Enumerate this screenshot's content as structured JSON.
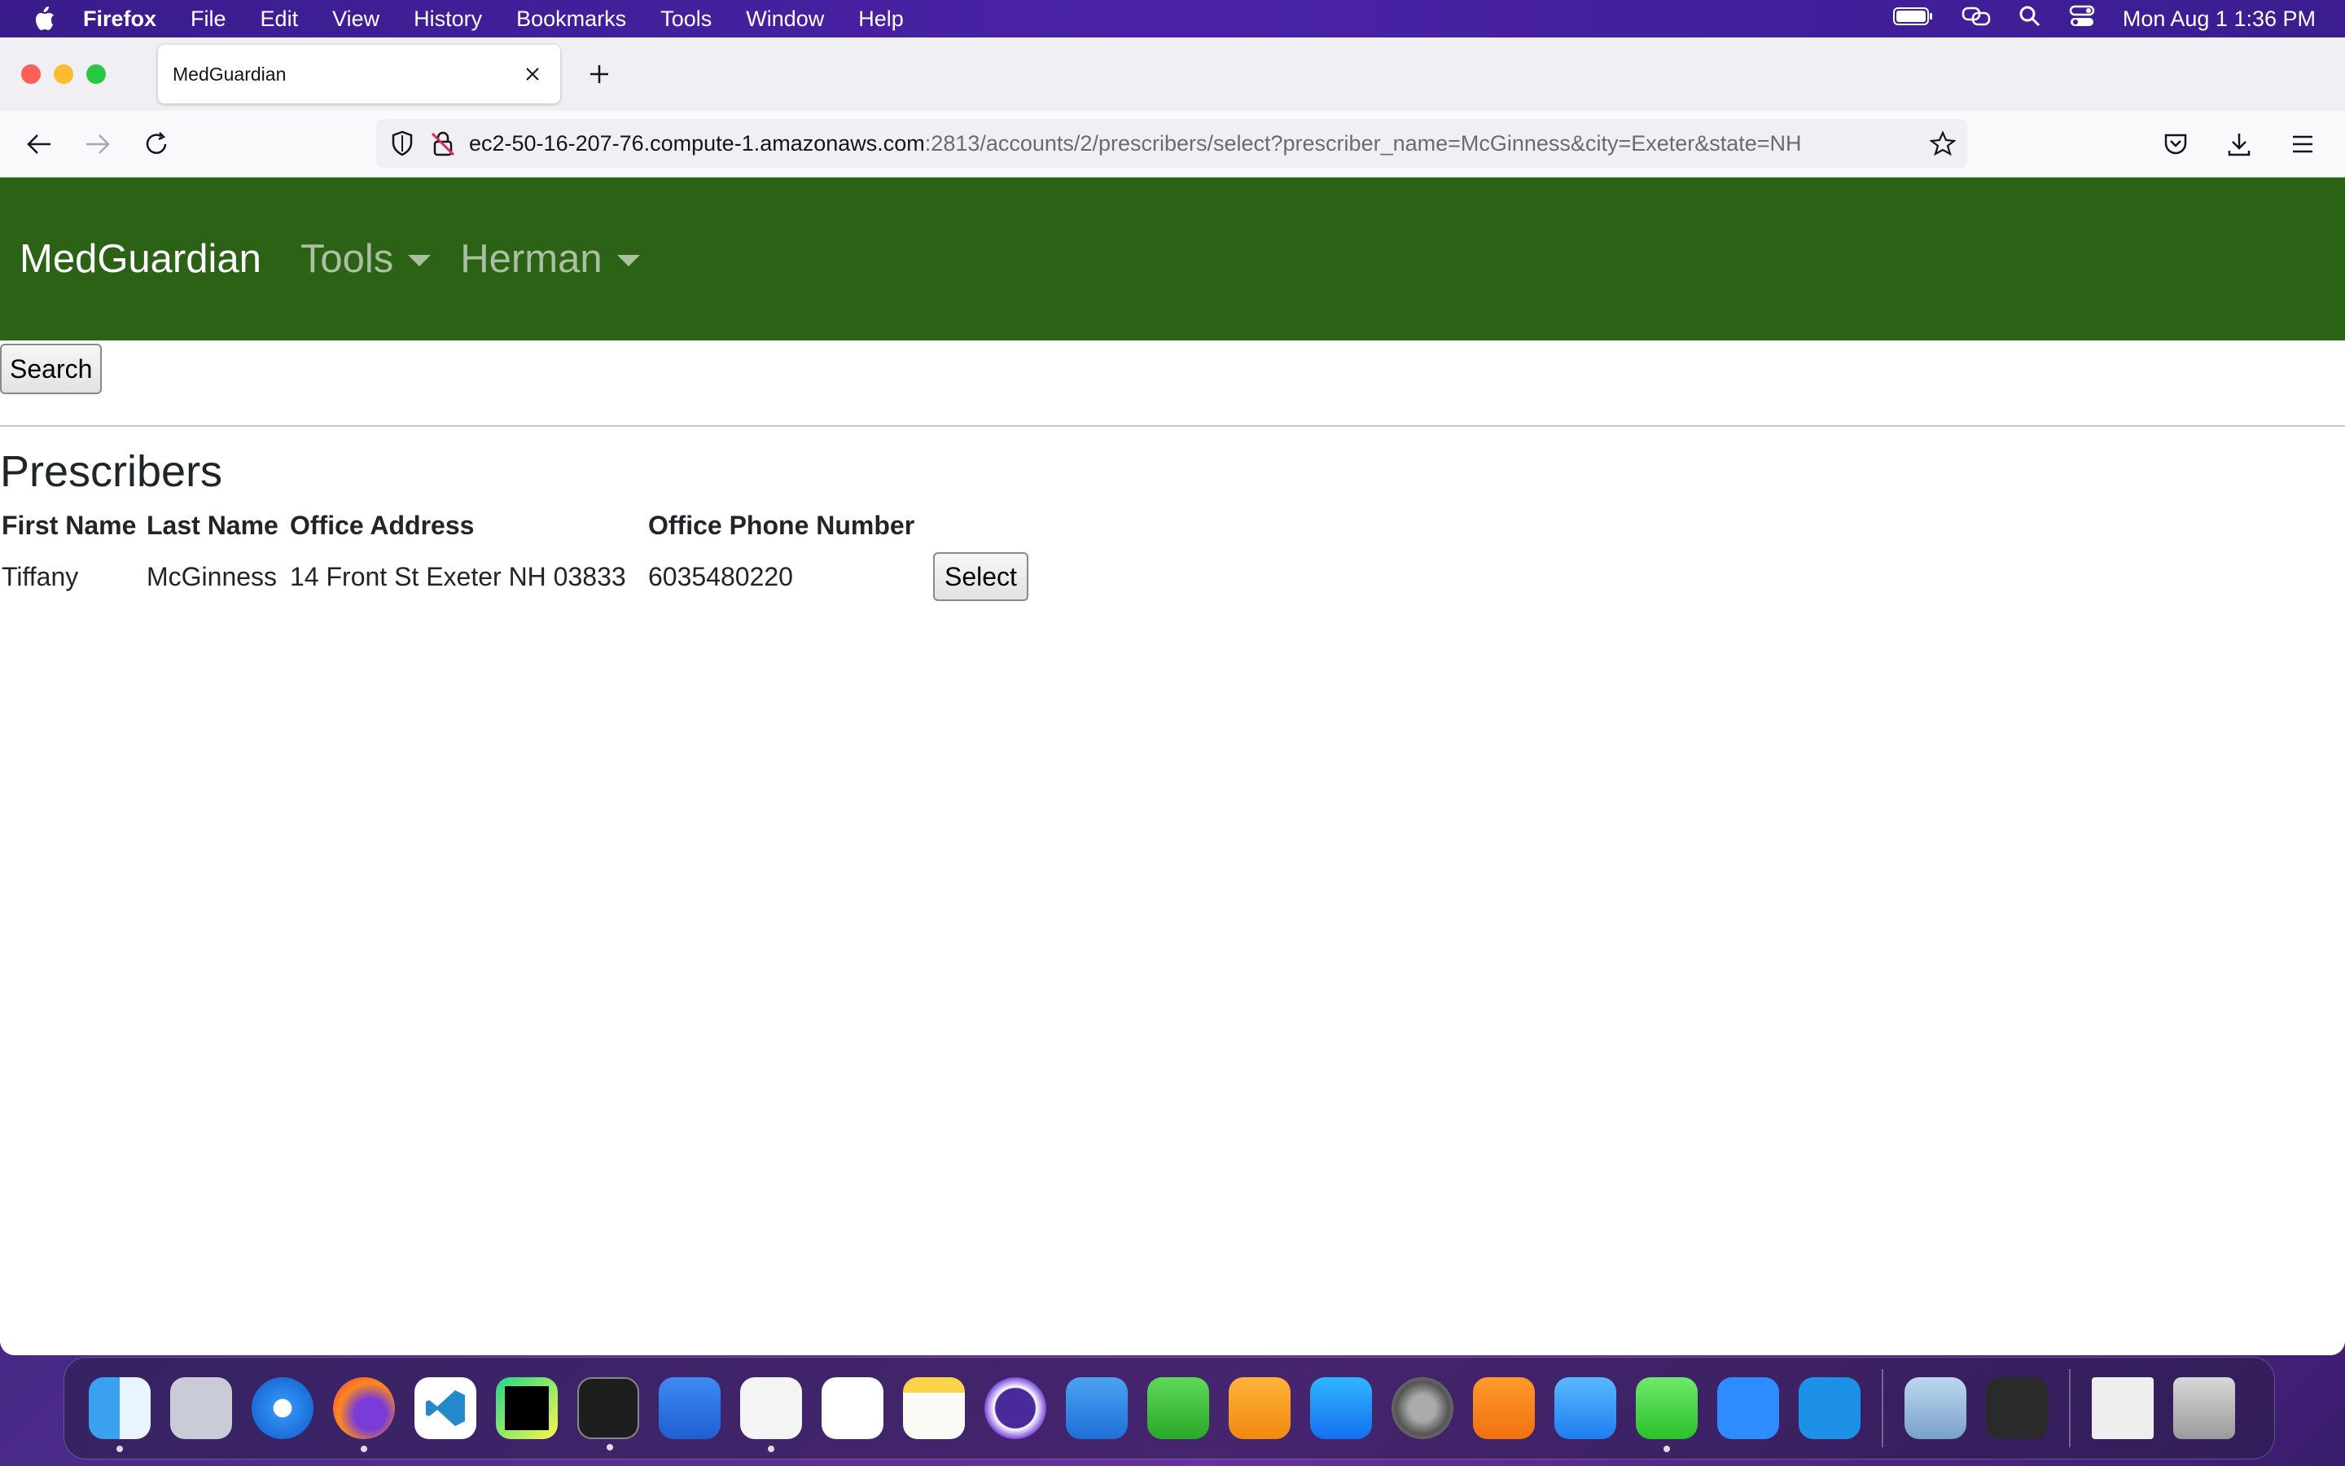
{
  "menubar": {
    "app_name": "Firefox",
    "items": [
      "File",
      "Edit",
      "View",
      "History",
      "Bookmarks",
      "Tools",
      "Window",
      "Help"
    ],
    "clock": "Mon Aug 1  1:36 PM"
  },
  "browser": {
    "tab_title": "MedGuardian",
    "url_host": "ec2-50-16-207-76.compute-1.amazonaws.com",
    "url_path": ":2813/accounts/2/prescribers/select?prescriber_name=McGinness&city=Exeter&state=NH"
  },
  "site": {
    "brand": "MedGuardian",
    "nav_tools": "Tools",
    "nav_user": "Herman",
    "search_button": "Search",
    "page_title": "Prescribers",
    "table": {
      "headers": [
        "First Name",
        "Last Name",
        "Office Address",
        "Office Phone Number"
      ],
      "rows": [
        {
          "first_name": "Tiffany",
          "last_name": "McGinness",
          "address": "14 Front St Exeter NH 03833",
          "phone": "6035480220",
          "action": "Select"
        }
      ]
    },
    "colors": {
      "navbar": "#2c6216"
    }
  },
  "dock": {
    "apps": [
      "Finder",
      "Launchpad",
      "Safari",
      "Firefox",
      "Visual Studio Code",
      "PyCharm",
      "Terminal",
      "Xcode",
      "TextEdit",
      "Reminders",
      "Notes",
      "Tor Browser",
      "Keynote",
      "Numbers",
      "Pages",
      "App Store",
      "System Preferences",
      "Books",
      "Mail",
      "Messages",
      "Zoom",
      "Docker",
      "Preview",
      "Keychain Access",
      "Documents",
      "Trash"
    ]
  }
}
